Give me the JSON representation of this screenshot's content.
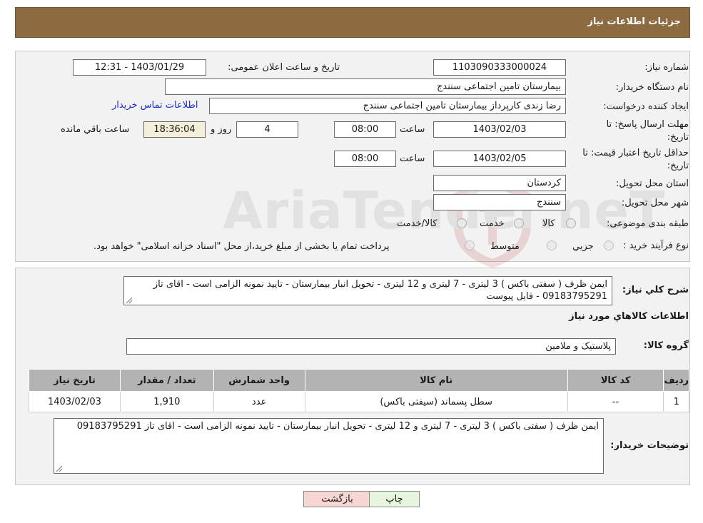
{
  "header": {
    "title": "جزئیات اطلاعات نیاز"
  },
  "fields": {
    "need_number_label": "شماره نیاز:",
    "need_number": "1103090333000024",
    "announce_label": "تاریخ و ساعت اعلان عمومی:",
    "announce_value": "1403/01/29 - 12:31",
    "buyer_org_label": "نام دستگاه خریدار:",
    "buyer_org": "بیمارستان تامین اجتماعی سنندج",
    "creator_label": "ایجاد کننده درخواست:",
    "creator": "رضا زندی کارپرداز بیمارستان تامین اجتماعی سنندج",
    "contact_link": "اطلاعات تماس خریدار",
    "deadline_label": "مهلت ارسال پاسخ: تا تاریخ:",
    "deadline_date": "1403/02/03",
    "time_label": "ساعت",
    "deadline_time": "08:00",
    "days_value": "4",
    "days_label": "روز و",
    "remaining_time": "18:36:04",
    "remaining_label": "ساعت باقي مانده",
    "price_validity_label": "حداقل تاریخ اعتبار قیمت: تا تاریخ:",
    "price_validity_date": "1403/02/05",
    "price_validity_time": "08:00",
    "province_label": "استان محل تحویل:",
    "province": "کردستان",
    "city_label": "شهر محل تحویل:",
    "city": "سنندج",
    "category_label": "طبقه بندی موضوعی:",
    "category_options": [
      "کالا",
      "خدمت",
      "کالا/خدمت"
    ],
    "process_label": "نوع فرآیند خرید :",
    "process_options": [
      "جزیي",
      "متوسط"
    ],
    "process_note": "پرداخت تمام یا بخشی از مبلغ خرید،از محل \"اسناد خزانه اسلامی\" خواهد بود."
  },
  "watermark": {
    "text": "AriaTender.neT"
  },
  "details": {
    "summary_label": "شرح کلي نياز:",
    "summary_text": "ایمن ظرف ( سفتی باکس ) 3 لیتری - 7 لیتری و 12 لیتری - تحویل انبار بیمارستان - تایید نمونه الزامی است  - اقای تاز 09183795291 - فایل پیوست",
    "goods_info_title": "اطلاعات کالاهاي مورد نياز",
    "goods_group_label": "گروه کالا:",
    "goods_group": "پلاستیک و ملامین",
    "table": {
      "headers": [
        "رديف",
        "کد کالا",
        "نام کالا",
        "واحد شمارش",
        "تعداد / مقدار",
        "تاریخ نیاز"
      ],
      "rows": [
        [
          "1",
          "--",
          "سطل پسماند (سیفتی باکس)",
          "عدد",
          "1,910",
          "1403/02/03"
        ]
      ]
    },
    "buyer_notes_label": "توضیحات خریدار:",
    "buyer_notes": "ایمن ظرف ( سفتی باکس ) 3 لیتری - 7 لیتری و 12 لیتری - تحویل انبار بیمارستان - تایید نمونه الزامی است  - اقای تاز 09183795291"
  },
  "buttons": {
    "print": "چاپ",
    "back": "بازگشت"
  }
}
